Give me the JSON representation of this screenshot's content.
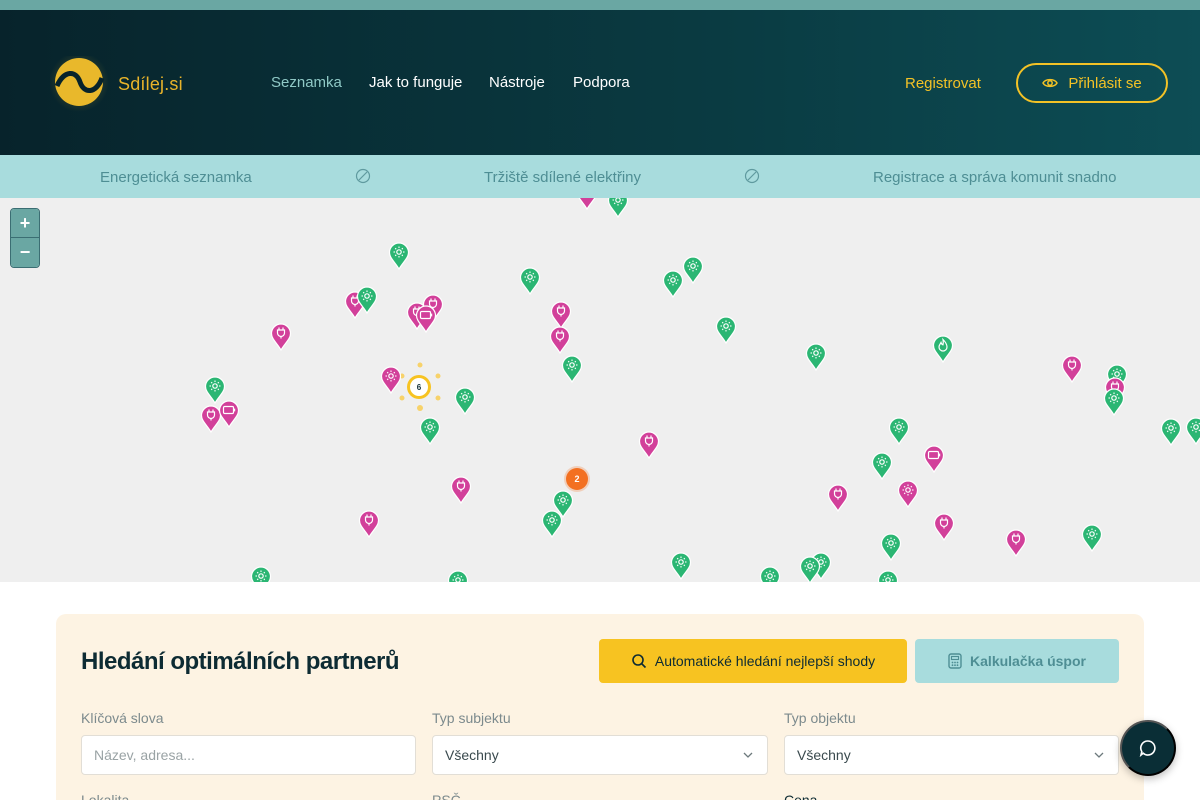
{
  "brand": {
    "name": "Sdílej.si"
  },
  "nav": {
    "items": [
      {
        "label": "Seznamka",
        "active": true
      },
      {
        "label": "Jak to funguje",
        "active": false
      },
      {
        "label": "Nástroje",
        "active": false
      },
      {
        "label": "Podpora",
        "active": false
      }
    ],
    "register_label": "Registrovat",
    "login_label": "Přihlásit se"
  },
  "ticker": {
    "items": [
      "Energetická seznamka",
      "Tržiště sdílené elektřiny",
      "Registrace a správa komunit snadno"
    ]
  },
  "map": {
    "zoom_in": "+",
    "zoom_out": "−",
    "cluster_counts": [
      "6",
      "2"
    ],
    "marker_types": [
      "solar-icon",
      "plug-icon",
      "battery-icon",
      "flame-icon"
    ]
  },
  "search": {
    "title": "Hledání optimálních partnerů",
    "auto_button": "Automatické hledání nejlepší shody",
    "calc_button": "Kalkulačka úspor",
    "keywords_label": "Klíčová slova",
    "keywords_placeholder": "Název, adresa...",
    "subject_type_label": "Typ subjektu",
    "subject_type_value": "Všechny",
    "object_type_label": "Typ objektu",
    "object_type_value": "Všechny",
    "location_label": "Lokalita",
    "zip_label": "PSČ",
    "price_label": "Cena"
  },
  "colors": {
    "header_bg": "#07232b",
    "accent": "#f3c226",
    "ticker_bg": "#a8dcdd",
    "marker_green": "#2bb673",
    "marker_pink": "#d2409a",
    "cluster_orange": "#f37021"
  }
}
